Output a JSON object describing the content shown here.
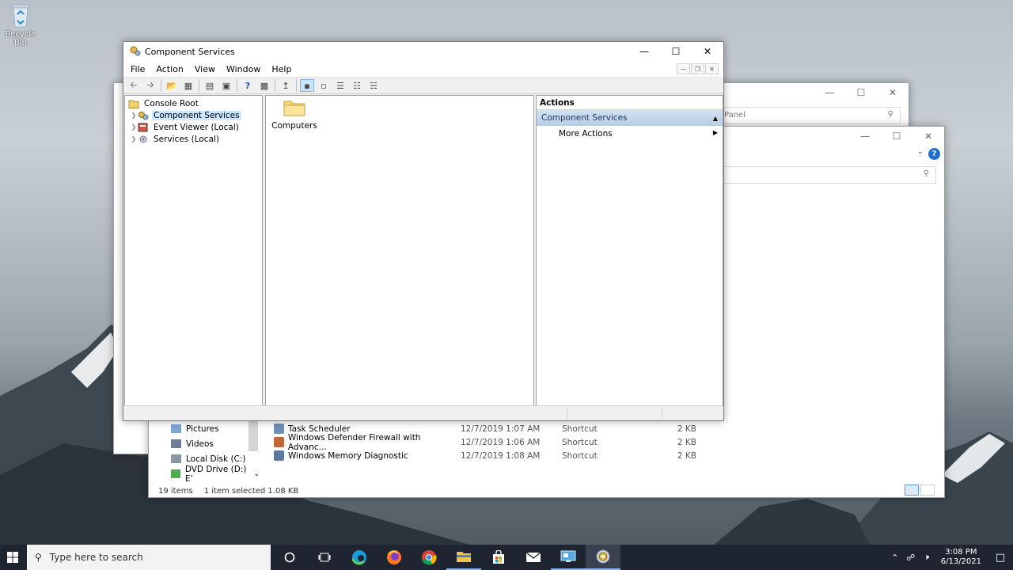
{
  "desktop": {
    "recycle_bin_label": "Recycle Bin"
  },
  "back_window1": {
    "address_text": "Panel"
  },
  "explorer": {
    "sidebar": [
      "Pictures",
      "Videos",
      "Local Disk (C:)",
      "DVD Drive (D:) E’"
    ],
    "rows": [
      {
        "name": "Task Scheduler",
        "date": "12/7/2019 1:07 AM",
        "type": "Shortcut",
        "size": "2 KB",
        "color": "#6d8fb3"
      },
      {
        "name": "Windows Defender Firewall with Advanc...",
        "date": "12/7/2019 1:06 AM",
        "type": "Shortcut",
        "size": "2 KB",
        "color": "#c0673a"
      },
      {
        "name": "Windows Memory Diagnostic",
        "date": "12/7/2019 1:08 AM",
        "type": "Shortcut",
        "size": "2 KB",
        "color": "#5a7aa0"
      }
    ],
    "status_count": "19 items",
    "status_selected": "1 item selected  1.08 KB"
  },
  "mmc": {
    "title": "Component Services",
    "menu": [
      "File",
      "Action",
      "View",
      "Window",
      "Help"
    ],
    "tree": {
      "root": "Console Root",
      "items": [
        "Component Services",
        "Event Viewer (Local)",
        "Services (Local)"
      ]
    },
    "content": {
      "folder_label": "Computers"
    },
    "actions": {
      "header": "Actions",
      "section": "Component Services",
      "item": "More Actions"
    }
  },
  "taskbar": {
    "search_placeholder": "Type here to search",
    "time": "3:08 PM",
    "date": "6/13/2021"
  }
}
